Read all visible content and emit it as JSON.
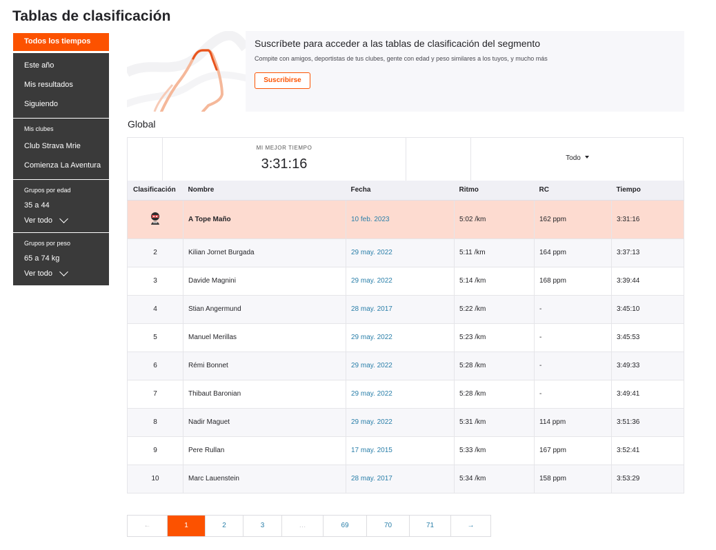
{
  "page": {
    "title": "Tablas de clasificación"
  },
  "sidebar": {
    "active": "Todos los tiempos",
    "time_items": [
      "Este año",
      "Mis resultados",
      "Siguiendo"
    ],
    "clubs_heading": "Mis clubes",
    "clubs": [
      "Club Strava Mrie",
      "Comienza La Aventura"
    ],
    "age_heading": "Grupos por edad",
    "age_value": "35 a 44",
    "age_view_all": "Ver todo",
    "weight_heading": "Grupos por peso",
    "weight_value": "65 a 74 kg",
    "weight_view_all": "Ver todo"
  },
  "promo": {
    "title": "Suscríbete para acceder a las tablas de clasificación del segmento",
    "description": "Compite con amigos, deportistas de tus clubes, gente con edad y peso similares a los tuyos, y mucho más",
    "button": "Suscribirse"
  },
  "leaderboard": {
    "section_title": "Global",
    "best_label": "MI MEJOR TIEMPO",
    "best_value": "3:31:16",
    "filter": "Todo",
    "columns": [
      "Clasificación",
      "Nombre",
      "Fecha",
      "Ritmo",
      "RC",
      "Tiempo"
    ],
    "rows": [
      {
        "rank": "",
        "name": "A Tope Maño",
        "date": "10 feb. 2023",
        "pace": "5:02 /km",
        "hr": "162 ppm",
        "time": "3:31:16"
      },
      {
        "rank": "2",
        "name": "Kilian Jornet Burgada",
        "date": "29 may. 2022",
        "pace": "5:11 /km",
        "hr": "164 ppm",
        "time": "3:37:13"
      },
      {
        "rank": "3",
        "name": "Davide Magnini",
        "date": "29 may. 2022",
        "pace": "5:14 /km",
        "hr": "168 ppm",
        "time": "3:39:44"
      },
      {
        "rank": "4",
        "name": "Stian Angermund",
        "date": "28 may. 2017",
        "pace": "5:22 /km",
        "hr": "-",
        "time": "3:45:10"
      },
      {
        "rank": "5",
        "name": "Manuel Merillas",
        "date": "29 may. 2022",
        "pace": "5:23 /km",
        "hr": "-",
        "time": "3:45:53"
      },
      {
        "rank": "6",
        "name": "Rémi Bonnet",
        "date": "29 may. 2022",
        "pace": "5:28 /km",
        "hr": "-",
        "time": "3:49:33"
      },
      {
        "rank": "7",
        "name": "Thibaut Baronian",
        "date": "29 may. 2022",
        "pace": "5:28 /km",
        "hr": "-",
        "time": "3:49:41"
      },
      {
        "rank": "8",
        "name": "Nadir Maguet",
        "date": "29 may. 2022",
        "pace": "5:31 /km",
        "hr": "114 ppm",
        "time": "3:51:36"
      },
      {
        "rank": "9",
        "name": "Pere Rullan",
        "date": "17 may. 2015",
        "pace": "5:33 /km",
        "hr": "167 ppm",
        "time": "3:52:41"
      },
      {
        "rank": "10",
        "name": "Marc Lauenstein",
        "date": "28 may. 2017",
        "pace": "5:34 /km",
        "hr": "158 ppm",
        "time": "3:53:29"
      }
    ]
  },
  "pagination": {
    "prev": "←",
    "pages": [
      "1",
      "2",
      "3",
      "…",
      "69",
      "70",
      "71"
    ],
    "active": "1",
    "next": "→"
  },
  "colors": {
    "accent": "#fc5200",
    "sidebar_bg": "#3a3a3a",
    "highlight_row": "#fddbd0",
    "link": "#2a7fa9"
  }
}
